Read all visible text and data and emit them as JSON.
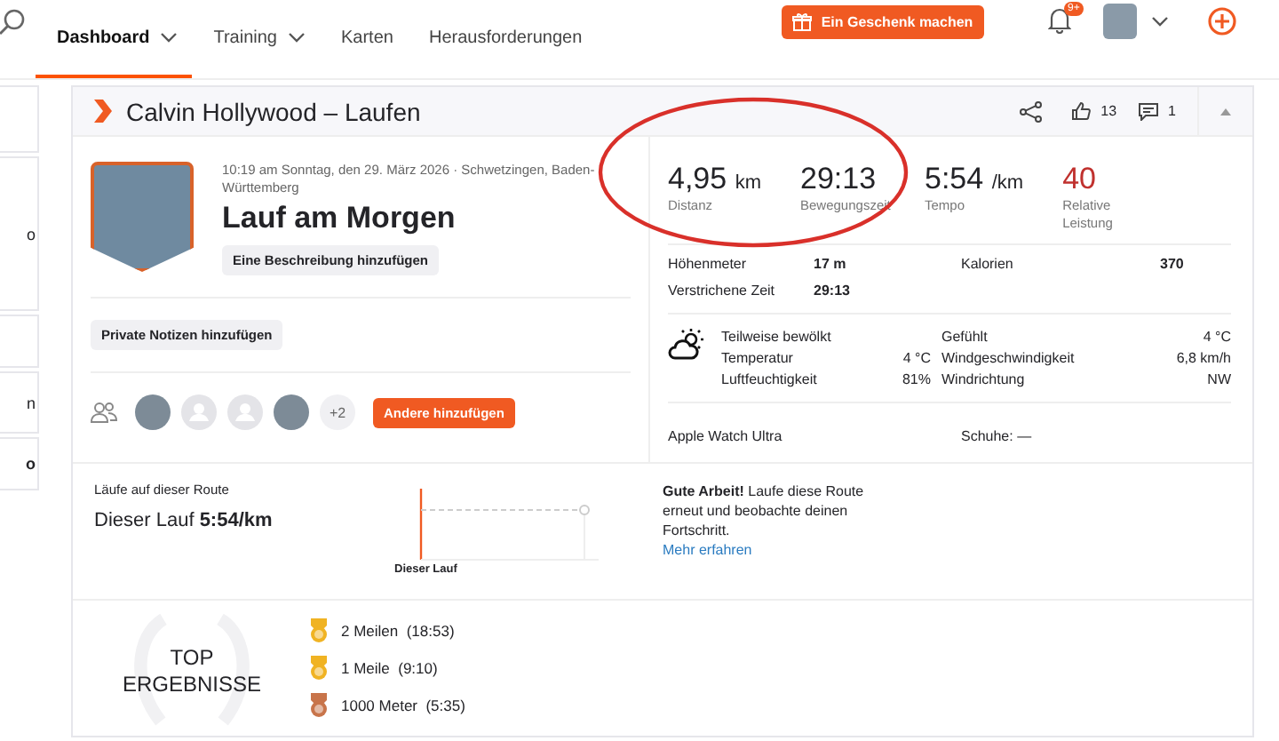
{
  "nav": {
    "items": [
      {
        "label": "Dashboard",
        "selected": true,
        "dropdown": true
      },
      {
        "label": "Training",
        "selected": false,
        "dropdown": true
      },
      {
        "label": "Karten",
        "selected": false,
        "dropdown": false
      },
      {
        "label": "Herausforderungen",
        "selected": false,
        "dropdown": false
      }
    ],
    "gift_button": "Ein Geschenk machen",
    "notification_badge": "9+"
  },
  "sidebar": {
    "fragments": [
      "o",
      "n",
      "o"
    ]
  },
  "activity": {
    "title": "Calvin Hollywood – Laufen",
    "kudos": "13",
    "comments": "1",
    "datetime": "10:19 am Sonntag, den 29. März 2026 · Schwetzingen, Baden-Württemberg",
    "name": "Lauf am Morgen",
    "add_description": "Eine Beschreibung hinzufügen",
    "private_notes": "Private Notizen hinzufügen",
    "group": {
      "avatars": [
        {
          "kind": "photo"
        },
        {
          "kind": "default"
        },
        {
          "kind": "default"
        },
        {
          "kind": "photo"
        }
      ],
      "more": "+2",
      "add_others": "Andere hinzufügen"
    },
    "stats": [
      {
        "value": "4,95",
        "unit": "km",
        "label": "Distanz",
        "kind": "plain"
      },
      {
        "value": "29:13",
        "label": "Bewegungszeit",
        "kind": "plain"
      },
      {
        "value": "5:54",
        "unit": "/km",
        "label": "Tempo",
        "kind": "plain"
      },
      {
        "value": "40",
        "label": "Relative Leistung",
        "kind": "effort"
      }
    ],
    "details": [
      {
        "label": "Höhenmeter",
        "value": "17 m"
      },
      {
        "label": "Kalorien",
        "value": "370"
      },
      {
        "label": "Verstrichene Zeit",
        "value": "29:13"
      }
    ],
    "weather": {
      "condition": "Teilweise bewölkt",
      "items": [
        {
          "label": "Gefühlt",
          "value": "4 °C"
        },
        {
          "label": "Temperatur",
          "value": "4 °C"
        },
        {
          "label": "Windgeschwindigkeit",
          "value": "6,8 km/h"
        },
        {
          "label": "Luftfeuchtigkeit",
          "value": "81%"
        },
        {
          "label": "Windrichtung",
          "value": "NW"
        }
      ]
    },
    "device": "Apple Watch Ultra",
    "shoes": "Schuhe: —"
  },
  "route": {
    "heading": "Läufe auf dieser Route",
    "this_run": "Dieser Lauf **5:54/km**",
    "chart_label": "Dieser Lauf",
    "message": "**Gute Arbeit!** Laufe diese Route erneut und beobachte deinen Fortschritt.",
    "link": "Mehr erfahren"
  },
  "top_results": {
    "title": "TOP ERGEBNISSE",
    "items": [
      {
        "text": "2 Meilen  (18:53)",
        "color": "#f0b323"
      },
      {
        "text": "1 Meile  (9:10)",
        "color": "#f0b323"
      },
      {
        "text": "1000 Meter  (5:35)",
        "color": "#c8744a"
      }
    ]
  },
  "annotation": {
    "kind": "ellipse"
  }
}
